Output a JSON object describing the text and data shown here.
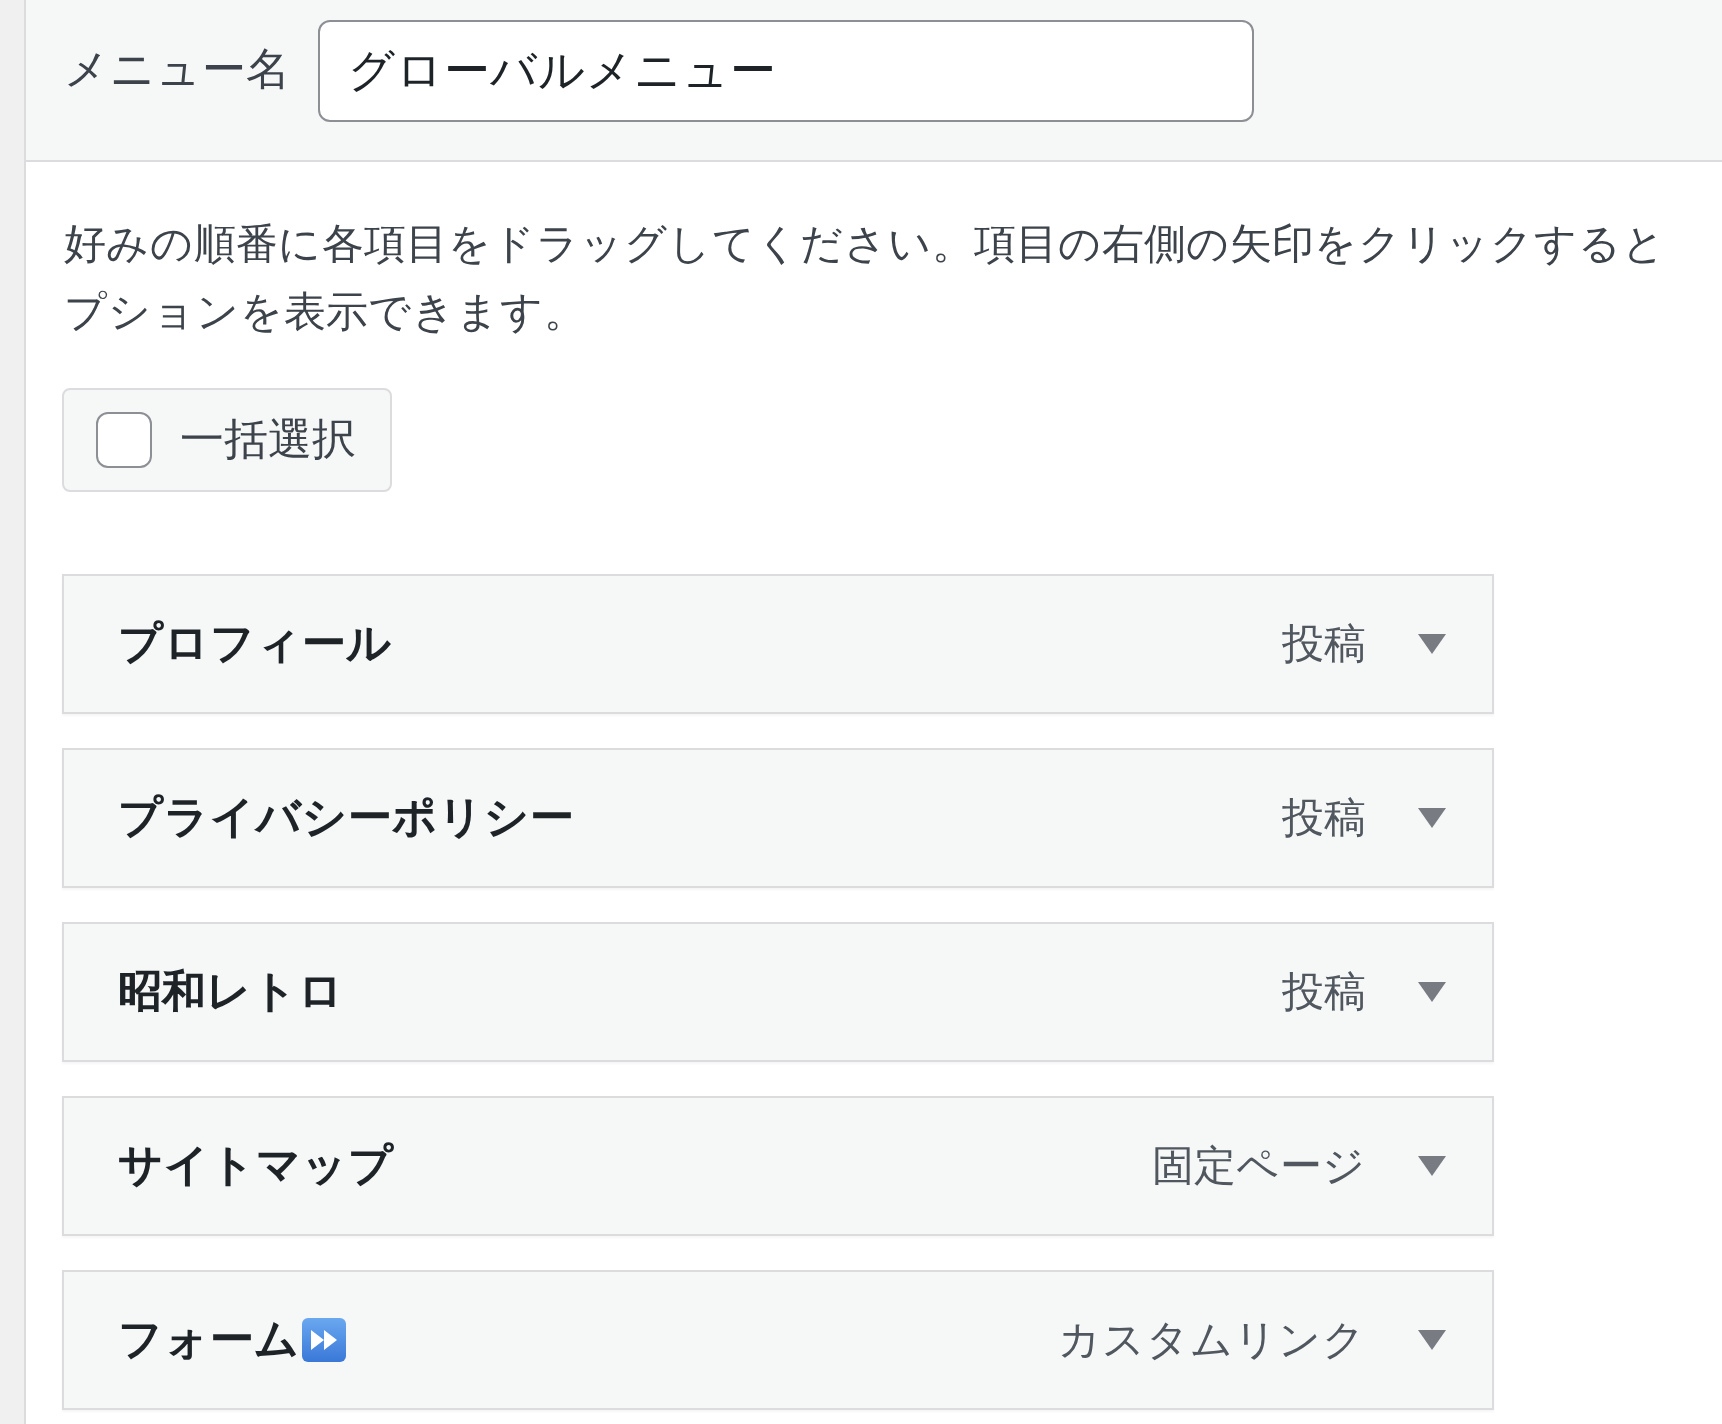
{
  "menu_name": {
    "label": "メニュー名",
    "value": "グローバルメニュー"
  },
  "instructions": [
    "好みの順番に各項目をドラッグしてください。項目の右側の矢印をクリックすると",
    "プションを表示できます。"
  ],
  "select_all": {
    "label": "一括選択",
    "checked": false
  },
  "menu_items": [
    {
      "title": "プロフィール",
      "type": "投稿",
      "title_icon": false,
      "expanded": false
    },
    {
      "title": "プライバシーポリシー",
      "type": "投稿",
      "title_icon": false,
      "expanded": false
    },
    {
      "title": "昭和レトロ",
      "type": "投稿",
      "title_icon": false,
      "expanded": false
    },
    {
      "title": "サイトマップ",
      "type": "固定ページ",
      "title_icon": false,
      "expanded": false
    },
    {
      "title": "フォーム",
      "type": "カスタムリンク",
      "title_icon": true,
      "expanded": false
    }
  ]
}
